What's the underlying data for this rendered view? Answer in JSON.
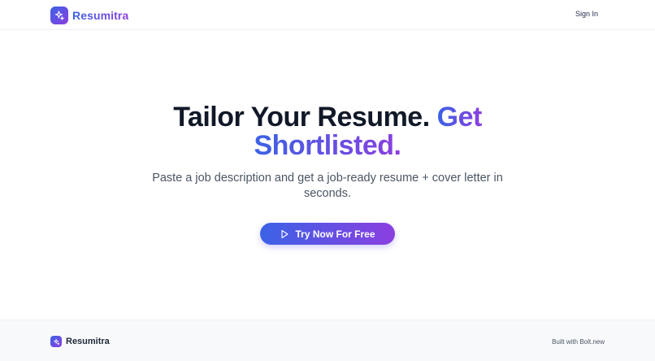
{
  "header": {
    "brand_name": "Resumitra",
    "logo_icon": "sparkles-icon",
    "signin_label": "Sign In"
  },
  "hero": {
    "title_plain": "Tailor Your Resume.",
    "title_gradient_line1": "Get",
    "title_gradient_line2": "Shortlisted.",
    "subtitle": "Paste a job description and get a job-ready resume + cover letter in seconds.",
    "cta_label": "Try Now For Free",
    "cta_icon": "play-icon"
  },
  "footer": {
    "brand_name": "Resumitra",
    "built_with": "Built with Bolt.new"
  },
  "colors": {
    "gradient_start": "#3b62e6",
    "gradient_end": "#8b3fe0",
    "heading": "#111827",
    "body_text": "#4b5563",
    "footer_bg": "#f8f9fb"
  }
}
